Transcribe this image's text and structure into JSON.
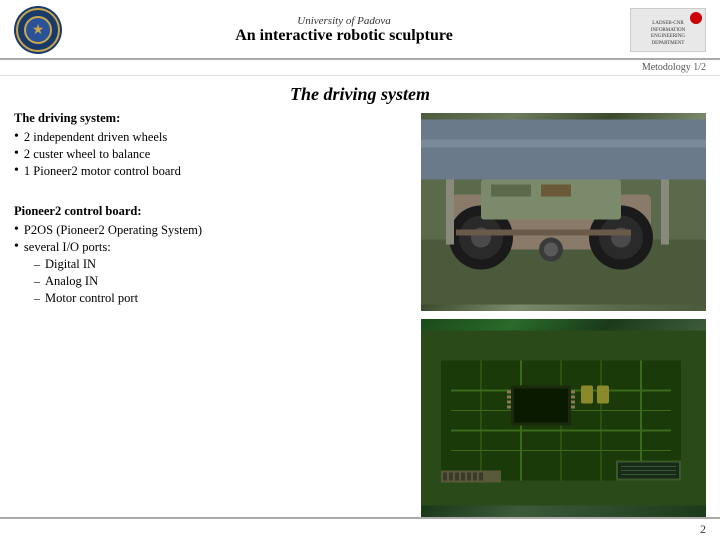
{
  "header": {
    "university": "University of Padova",
    "title": "An interactive robotic sculpture"
  },
  "metodology": "Metodology  1/2",
  "section_title": "The driving system",
  "text_block1": {
    "heading": "The driving system:",
    "bullets": [
      "2 independent driven wheels",
      "2 custer wheel to balance",
      "1 Pioneer2 motor control board"
    ]
  },
  "text_block2": {
    "heading": "Pioneer2 control board:",
    "bullets": [
      "P2OS (Pioneer2 Operating System)",
      "several I/O ports:"
    ],
    "sub_items": [
      "Digital IN",
      "Analog IN",
      "Motor control port"
    ]
  },
  "page_number": "2"
}
